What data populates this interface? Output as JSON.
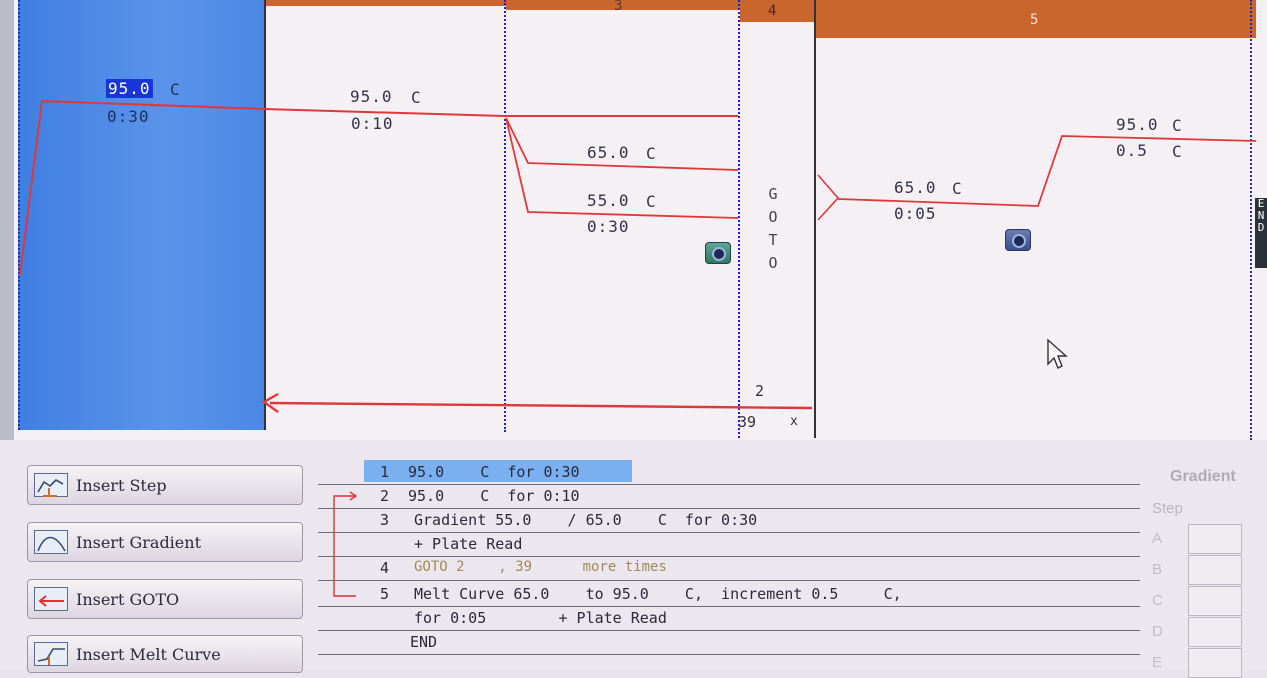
{
  "graph": {
    "step_numbers": [
      "3",
      "4",
      "5"
    ],
    "step1": {
      "temp": "95.0",
      "unit": "C",
      "time": "0:30"
    },
    "step2": {
      "temp": "95.0",
      "unit": "C",
      "time": "0:10"
    },
    "step3": {
      "temp_high": "65.0",
      "temp_low": "55.0",
      "unit": "C",
      "time": "0:30"
    },
    "step4_label": [
      "G",
      "O",
      "T",
      "O"
    ],
    "step4_target": "2",
    "step4_repeat": "39",
    "step4_repeat_suffix": "x",
    "step5": {
      "temp_start": "65.0",
      "unit": "C",
      "time": "0:05",
      "temp_end": "95.0",
      "increment": "0.5"
    },
    "end_label": [
      "E",
      "N",
      "D"
    ]
  },
  "tools": {
    "insert_step": "Insert Step",
    "insert_gradient": "Insert Gradient",
    "insert_goto": "Insert GOTO",
    "insert_melt_curve": "Insert Melt Curve"
  },
  "protocol_lines": [
    {
      "num": "1",
      "text": "95.0    C  for 0:30"
    },
    {
      "num": "2",
      "text": "95.0    C  for 0:10"
    },
    {
      "num": "3",
      "text": "Gradient 55.0    / 65.0    C  for 0:30"
    },
    {
      "num": "",
      "text": "+ Plate Read"
    },
    {
      "num": "4",
      "text": "GOTO 2    , 39      more times"
    },
    {
      "num": "5",
      "text": "Melt Curve 65.0    to 95.0    C,  increment 0.5     C,"
    },
    {
      "num": "",
      "text": "for 0:05        + Plate Read"
    },
    {
      "num": "",
      "text": "END"
    }
  ],
  "gradient_panel": {
    "title": "Gradient",
    "step_label": "Step",
    "rows": [
      "A",
      "B",
      "C",
      "D",
      "E"
    ]
  },
  "colors": {
    "header_bar": "#c8662e",
    "selected_step": "#4a88e6",
    "trace": "#e03838",
    "row_highlight": "#7ab0f0"
  }
}
